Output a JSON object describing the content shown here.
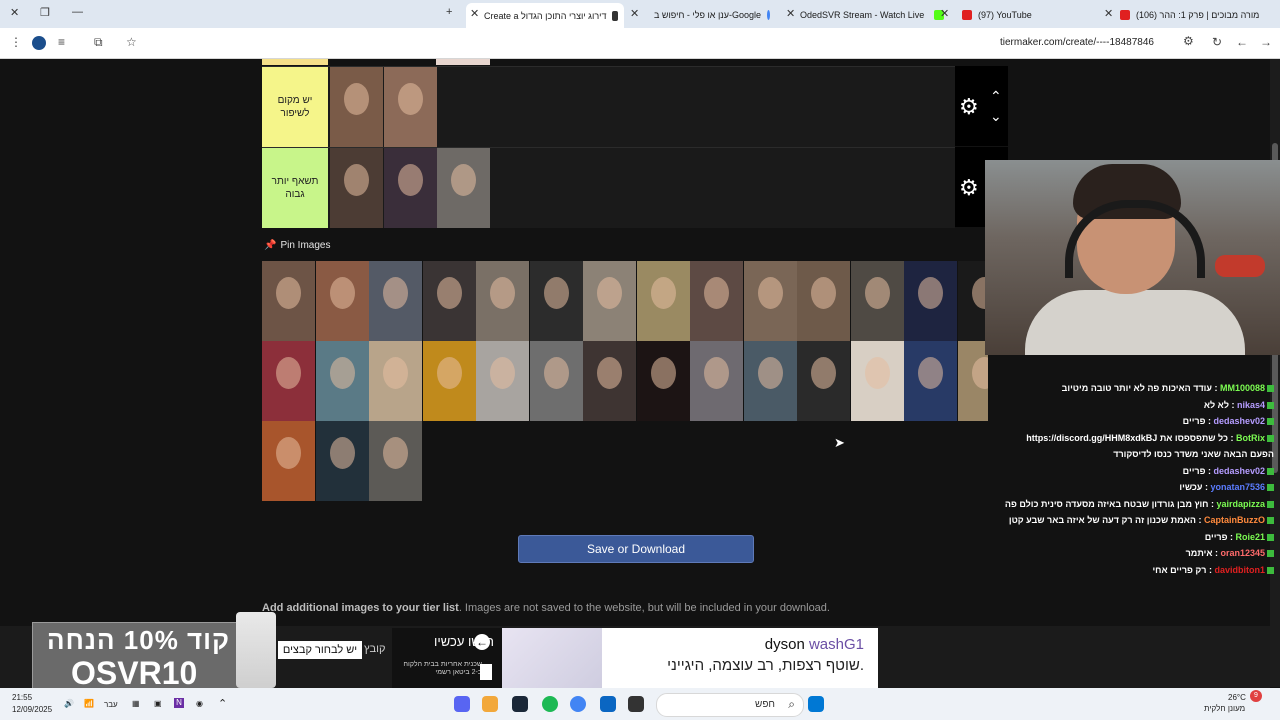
{
  "browser": {
    "tabs": [
      {
        "title": "(106) מורה מבוכים | פרק 1: ההר",
        "active": false
      },
      {
        "title": "(97) YouTube",
        "active": false
      },
      {
        "title": "OdedSVR Stream - Watch Live",
        "active": false
      },
      {
        "title": "ענן או פלי - חיפוש ב-Google",
        "active": false
      },
      {
        "title": "Create a דירוג יוצרי התוכן הגדול",
        "active": true
      }
    ],
    "url": "tiermaker.com/create/----18487846"
  },
  "tiers": [
    {
      "label": "יש מקום לשיפור",
      "color": "#f5f58a"
    },
    {
      "label": "תשאף יותר גבוה",
      "color": "#c8f58a"
    }
  ],
  "pin_images_label": "Pin Images",
  "save_button": "Save or Download",
  "add_images": {
    "bold": "Add additional images to your tier list",
    "rest": ". Images are not saved to the website, but will be included in your download."
  },
  "chat": [
    {
      "user": "MM100088",
      "color": "#7cfc52",
      "msg": "עודד האיכות פה לא יותר טובה מיטיוב"
    },
    {
      "user": "nikas4",
      "color": "#b59cff",
      "msg": "לא לא"
    },
    {
      "user": "dedashev02",
      "color": "#b59cff",
      "msg": "פריים"
    },
    {
      "user": "BotRix",
      "color": "#7cfc52",
      "msg": "https://discord.gg/HHM8xdkBJ כל שתפספסו את"
    },
    {
      "user": "",
      "color": "#ffffff",
      "msg": "הפעם הבאה שאני משדר כנסו לדיסקורד"
    },
    {
      "user": "dedashev02",
      "color": "#b59cff",
      "msg": "פריים"
    },
    {
      "user": "yonatan7536",
      "color": "#5b7cff",
      "msg": "עכשיו"
    },
    {
      "user": "yairdapizza",
      "color": "#7cfc52",
      "msg": "חוץ מבן גורדון שבטח באיזה מסעדה סינית כולם פה"
    },
    {
      "user": "CaptainBuzzO",
      "color": "#ff8a3d",
      "msg": "האמת שכנון זה רק דעה של איזה באר שבע קטן"
    },
    {
      "user": "Roie21",
      "color": "#7cfc52",
      "msg": "פריים"
    },
    {
      "user": "oran12345",
      "color": "#ff6b6b",
      "msg": "איתמר"
    },
    {
      "user": "davidbiton1",
      "color": "#e02020",
      "msg": "רק פריים אחי"
    }
  ],
  "overlay": {
    "promo_line1": "קוד 10% הנחה",
    "promo_line2": "OSVR10",
    "choose_file": "יש לבחור קבצים",
    "choose_file2": "קובץ"
  },
  "ad": {
    "cta": "רכשו עכשיו",
    "fine": "שכנית אחריות בבית הלקוח ב-2 ביטאן רשמי",
    "brand": "dyson",
    "brand_product": "washG1",
    "tagline": "שוטף רצפות, רב עוצמה, היגייני."
  },
  "taskbar": {
    "time": "21:55",
    "date": "12/09/2025",
    "lang": "עבר",
    "search": "חפש",
    "weather_temp": "26°C",
    "weather_desc": "מעונן חלקית",
    "notif_count": "9"
  },
  "colors": {
    "save_button": "#3b5998",
    "page_bg": "#121212",
    "pin_icon": "#e34b65"
  }
}
